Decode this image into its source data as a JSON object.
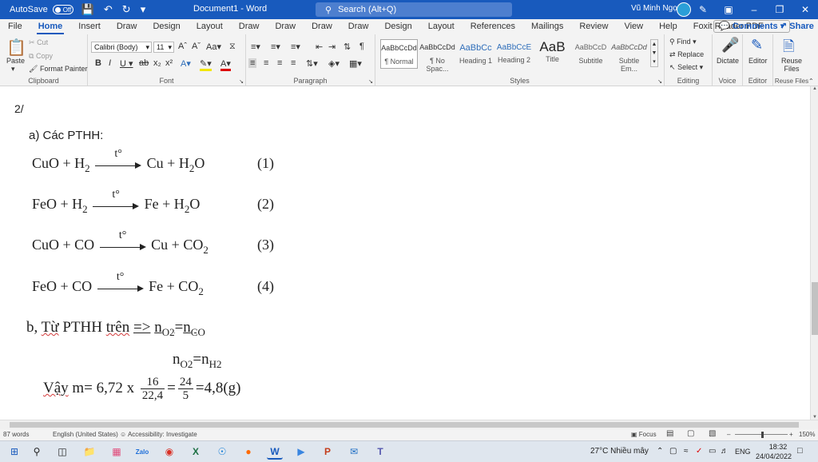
{
  "titlebar": {
    "autosave_label": "AutoSave",
    "autosave_state": "Off",
    "doc_title": "Document1 - Word",
    "search_placeholder": "Search (Alt+Q)",
    "user_name": "Vũ Minh Ngọc"
  },
  "tabs": [
    {
      "label": "File"
    },
    {
      "label": "Home"
    },
    {
      "label": "Insert"
    },
    {
      "label": "Draw"
    },
    {
      "label": "Design"
    },
    {
      "label": "Layout"
    },
    {
      "label": "Draw"
    },
    {
      "label": "Draw"
    },
    {
      "label": "Draw"
    },
    {
      "label": "Draw"
    },
    {
      "label": "Design"
    },
    {
      "label": "Layout"
    },
    {
      "label": "References"
    },
    {
      "label": "Mailings"
    },
    {
      "label": "Review"
    },
    {
      "label": "View"
    },
    {
      "label": "Help"
    },
    {
      "label": "Foxit Reader PDF"
    }
  ],
  "ribbon_actions": {
    "comments": "Comments",
    "share": "Share"
  },
  "clipboard": {
    "label": "Clipboard",
    "paste": "Paste",
    "cut": "Cut",
    "copy": "Copy",
    "format_painter": "Format Painter"
  },
  "font": {
    "label": "Font",
    "family": "Calibri (Body)",
    "size": "11"
  },
  "paragraph": {
    "label": "Paragraph"
  },
  "styles": {
    "label": "Styles",
    "items": [
      {
        "preview": "AaBbCcDd",
        "name": "¶ Normal"
      },
      {
        "preview": "AaBbCcDd",
        "name": "¶ No Spac..."
      },
      {
        "preview": "AaBbCc",
        "name": "Heading 1"
      },
      {
        "preview": "AaBbCcE",
        "name": "Heading 2"
      },
      {
        "preview": "AaB",
        "name": "Title"
      },
      {
        "preview": "AaBbCcD",
        "name": "Subtitle"
      },
      {
        "preview": "AaBbCcDd",
        "name": "Subtle Em..."
      }
    ]
  },
  "editing": {
    "label": "Editing",
    "find": "Find",
    "replace": "Replace",
    "select": "Select"
  },
  "voice": {
    "label": "Voice",
    "dictate": "Dictate"
  },
  "editor": {
    "label": "Editor",
    "editor_btn": "Editor"
  },
  "reuse": {
    "label": "Reuse Files",
    "reuse_btn": "Reuse Files"
  },
  "document": {
    "section": "2/",
    "part_a": "a) Các PTHH:",
    "condition": "t°",
    "equations": [
      {
        "lhs": [
          "CuO + H",
          "2"
        ],
        "rhs": [
          "Cu + H",
          "2",
          "O"
        ],
        "num": "(1)"
      },
      {
        "lhs": [
          "FeO + H",
          "2"
        ],
        "rhs": [
          "Fe + H",
          "2",
          "O"
        ],
        "num": "(2)"
      },
      {
        "lhs": [
          "CuO + CO",
          ""
        ],
        "rhs": [
          "Cu + CO",
          "2",
          ""
        ],
        "num": "(3)"
      },
      {
        "lhs": [
          "FeO + CO",
          ""
        ],
        "rhs": [
          "Fe + CO",
          "2",
          ""
        ],
        "num": "(4)"
      }
    ],
    "part_b_prefix": "b,",
    "part_b_tu": "Từ",
    "part_b_mid": "PTHH",
    "part_b_tren": "trên",
    "part_b_arrow": "=>",
    "n1": "n",
    "o2_sub": "O2",
    "eq_sign": "=",
    "nco": "n",
    "co_sub": "CO",
    "line2_n": "n",
    "line2_o2": "O2",
    "line2_eq": "=n",
    "line2_h2": "H2",
    "final_vay": "Vậy",
    "final_m": "m= 6,72 x",
    "frac1_num": "16",
    "frac1_den": "22,4",
    "mid_eq": "=",
    "frac2_num": "24",
    "frac2_den": "5",
    "final_result": "=4,8(g)"
  },
  "status": {
    "words": "87 words",
    "language": "English (United States)",
    "accessibility": "Accessibility: Investigate",
    "focus": "Focus",
    "zoom": "150%"
  },
  "taskbar": {
    "weather": "27°C  Nhiều mây",
    "lang": "ENG",
    "time": "18:32",
    "date": "24/04/2022"
  }
}
